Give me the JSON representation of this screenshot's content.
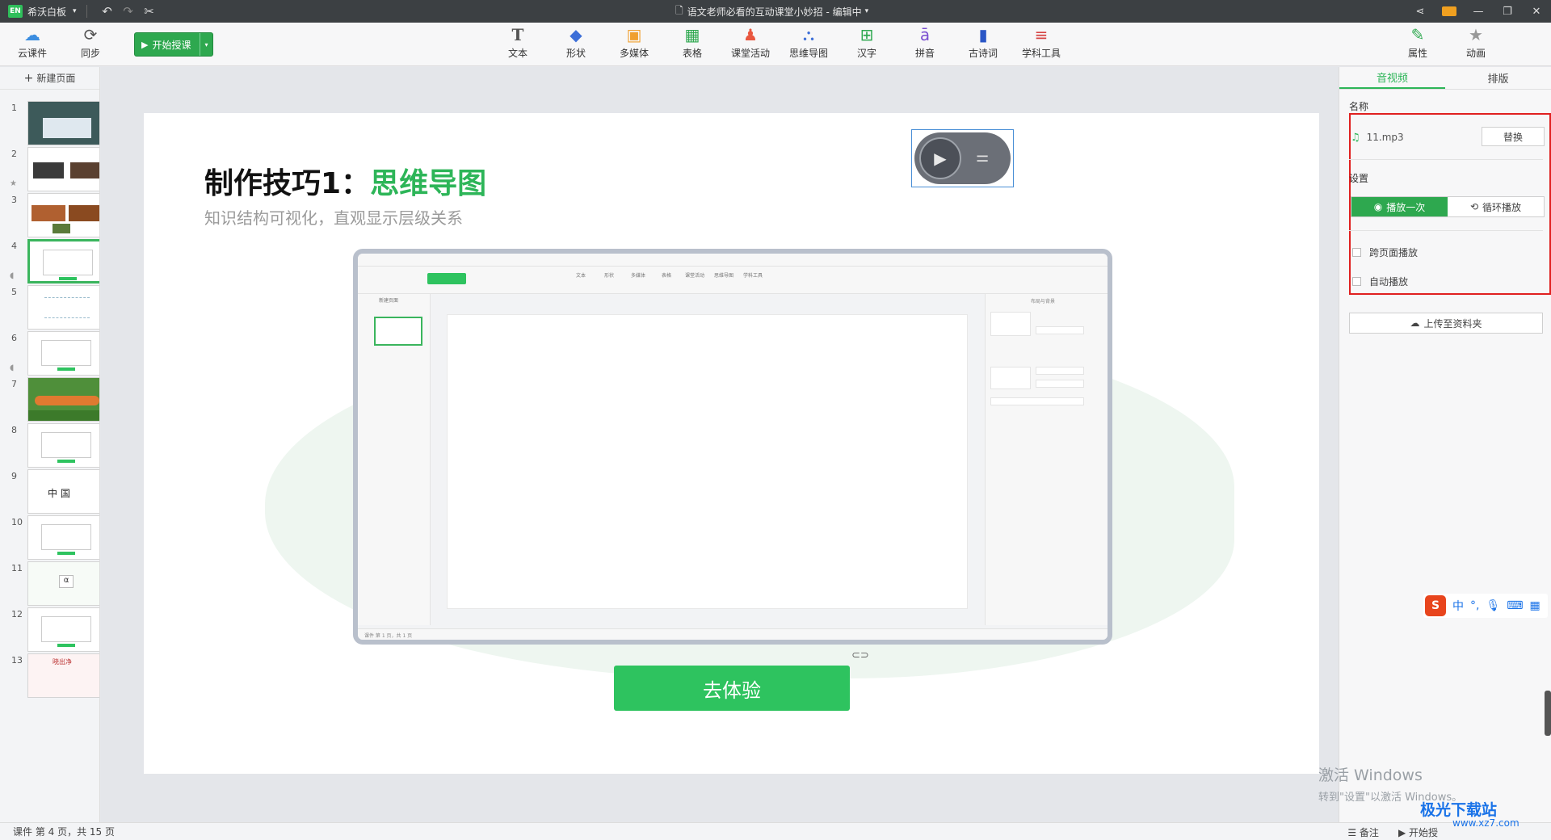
{
  "titlebar": {
    "logo": "EN",
    "app_name": "希沃白板",
    "doc_title": "语文老师必看的互动课堂小妙招 - 编辑中"
  },
  "toolbar": {
    "cloud": "云课件",
    "sync": "同步",
    "start": "开始授课",
    "tools": [
      "文本",
      "形状",
      "多媒体",
      "表格",
      "课堂活动",
      "思维导图",
      "汉字",
      "拼音",
      "古诗词",
      "学科工具"
    ],
    "props": "属性",
    "anim": "动画"
  },
  "left": {
    "new_page": "新建页面",
    "pages": [
      "1",
      "2",
      "3",
      "4",
      "5",
      "6",
      "7",
      "8",
      "9",
      "10",
      "11",
      "12",
      "13"
    ],
    "active_index": 3
  },
  "slide": {
    "title_prefix": "制作技巧1：",
    "title_highlight": "思维导图",
    "subtitle": "知识结构可视化，直观显示层级关系",
    "button": "去体验",
    "thumb9_text": "中 国",
    "thumb11_text": "α",
    "thumb13_text": "晓出净"
  },
  "mock": {
    "tools": [
      "文本",
      "形状",
      "多媒体",
      "表格",
      "课堂活动",
      "思维导图",
      "学科工具"
    ],
    "new_page": "新建页面",
    "panel_title": "布局与背景",
    "status": "课件 第 1 页，共 1 页"
  },
  "right": {
    "tab_av": "音视频",
    "tab_layout": "排版",
    "name_label": "名称",
    "file_name": "11.mp3",
    "replace": "替换",
    "settings_label": "设置",
    "play_once": "播放一次",
    "loop": "循环播放",
    "cross_page": "跨页面播放",
    "auto_play": "自动播放",
    "upload": "上传至资料夹"
  },
  "status": {
    "page_info": "课件 第 4 页，共 15 页",
    "notes": "备注",
    "start": "开始授"
  },
  "ime": {
    "label": "中"
  },
  "activate": {
    "line1": "激活 Windows",
    "line2": "转到\"设置\"以激活 Windows。"
  },
  "watermark": {
    "title": "极光下载站",
    "url": "www.xz7.com"
  }
}
